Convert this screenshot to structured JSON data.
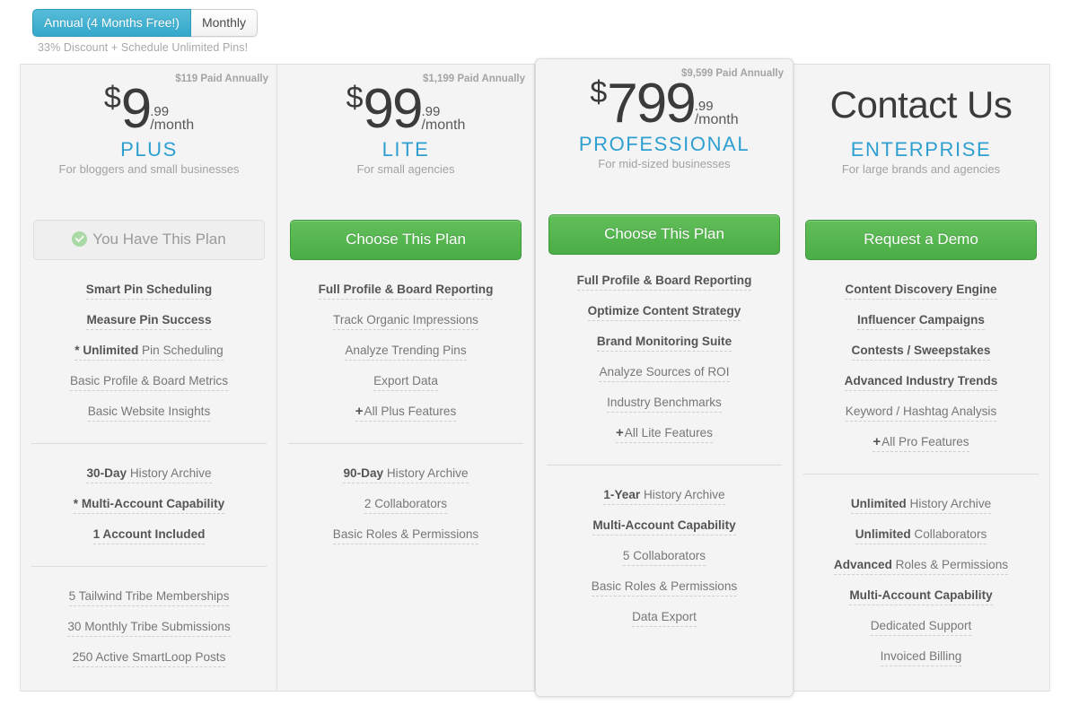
{
  "billing": {
    "annual_label": "Annual (4 Months Free!)",
    "monthly_label": "Monthly",
    "selected": "annual",
    "note": "33% Discount + Schedule Unlimited Pins!",
    "accent_active": "#35a8cb",
    "accent_cta": "#4aad46",
    "accent_plan_name": "#2e9fd0"
  },
  "plans": [
    {
      "id": "plus",
      "annual_note": "$119 Paid Annually",
      "currency": "$",
      "amount": "9",
      "cents": ".99",
      "per": "/month",
      "name": "PLUS",
      "tagline": "For bloggers and small businesses",
      "cta_label": "You Have This Plan",
      "cta_type": "owned",
      "cta_icon": "check-circle-icon",
      "group1": [
        {
          "bold": "Smart Pin Scheduling",
          "rest": ""
        },
        {
          "bold": "Measure Pin Success",
          "rest": ""
        },
        {
          "bold": "* Unlimited",
          "rest": " Pin Scheduling"
        },
        {
          "bold": "",
          "rest": "Basic Profile & Board Metrics"
        },
        {
          "bold": "",
          "rest": "Basic Website Insights"
        }
      ],
      "group2": [
        {
          "bold": "30-Day",
          "rest": " History Archive"
        },
        {
          "bold": "* Multi-Account Capability",
          "rest": ""
        },
        {
          "bold": "1 Account Included",
          "rest": ""
        }
      ],
      "group3": [
        {
          "bold": "",
          "rest": "5 Tailwind Tribe Memberships"
        },
        {
          "bold": "",
          "rest": "30 Monthly Tribe Submissions"
        },
        {
          "bold": "",
          "rest": "250 Active SmartLoop Posts"
        }
      ]
    },
    {
      "id": "lite",
      "annual_note": "$1,199 Paid Annually",
      "currency": "$",
      "amount": "99",
      "cents": ".99",
      "per": "/month",
      "name": "LITE",
      "tagline": "For small agencies",
      "cta_label": "Choose This Plan",
      "cta_type": "green",
      "cta_icon": "",
      "group1": [
        {
          "bold": "Full Profile & Board Reporting",
          "rest": ""
        },
        {
          "bold": "",
          "rest": "Track Organic Impressions"
        },
        {
          "bold": "",
          "rest": "Analyze Trending Pins"
        },
        {
          "bold": "",
          "rest": "Export Data"
        },
        {
          "plus": true,
          "bold": "",
          "rest": "All Plus Features"
        }
      ],
      "group2": [
        {
          "bold": "90-Day",
          "rest": " History Archive"
        },
        {
          "bold": "",
          "rest": "2 Collaborators"
        },
        {
          "bold": "",
          "rest": "Basic Roles & Permissions"
        }
      ],
      "group3": []
    },
    {
      "id": "professional",
      "featured": true,
      "annual_note": "$9,599 Paid Annually",
      "currency": "$",
      "amount": "799",
      "cents": ".99",
      "per": "/month",
      "name": "PROFESSIONAL",
      "tagline": "For mid-sized businesses",
      "cta_label": "Choose This Plan",
      "cta_type": "green",
      "cta_icon": "",
      "group1": [
        {
          "bold": "Full Profile & Board Reporting",
          "rest": ""
        },
        {
          "bold": "Optimize Content Strategy",
          "rest": ""
        },
        {
          "bold": "Brand Monitoring Suite",
          "rest": ""
        },
        {
          "bold": "",
          "rest": "Analyze Sources of ROI"
        },
        {
          "bold": "",
          "rest": "Industry Benchmarks"
        },
        {
          "plus": true,
          "bold": "",
          "rest": "All Lite Features"
        }
      ],
      "group2": [
        {
          "bold": "1-Year",
          "rest": " History Archive"
        },
        {
          "bold": "Multi-Account Capability",
          "rest": ""
        },
        {
          "bold": "",
          "rest": "5 Collaborators"
        },
        {
          "bold": "",
          "rest": "Basic Roles & Permissions"
        },
        {
          "bold": "",
          "rest": "Data Export"
        }
      ],
      "group3": []
    },
    {
      "id": "enterprise",
      "annual_note": "",
      "contact_label": "Contact Us",
      "name": "ENTERPRISE",
      "tagline": "For large brands and agencies",
      "cta_label": "Request a Demo",
      "cta_type": "green",
      "cta_icon": "",
      "group1": [
        {
          "bold": "Content Discovery Engine",
          "rest": ""
        },
        {
          "bold": "Influencer Campaigns",
          "rest": ""
        },
        {
          "bold": "Contests / Sweepstakes",
          "rest": ""
        },
        {
          "bold": "Advanced Industry Trends",
          "rest": ""
        },
        {
          "bold": "",
          "rest": "Keyword / Hashtag Analysis"
        },
        {
          "plus": true,
          "bold": "",
          "rest": "All Pro Features"
        }
      ],
      "group2": [
        {
          "bold": "Unlimited",
          "rest": " History Archive"
        },
        {
          "bold": "Unlimited",
          "rest": " Collaborators"
        },
        {
          "bold": "Advanced",
          "rest": " Roles & Permissions"
        },
        {
          "bold": "Multi-Account Capability",
          "rest": ""
        },
        {
          "bold": "",
          "rest": "Dedicated Support"
        },
        {
          "bold": "",
          "rest": "Invoiced Billing"
        }
      ],
      "group3": []
    }
  ]
}
